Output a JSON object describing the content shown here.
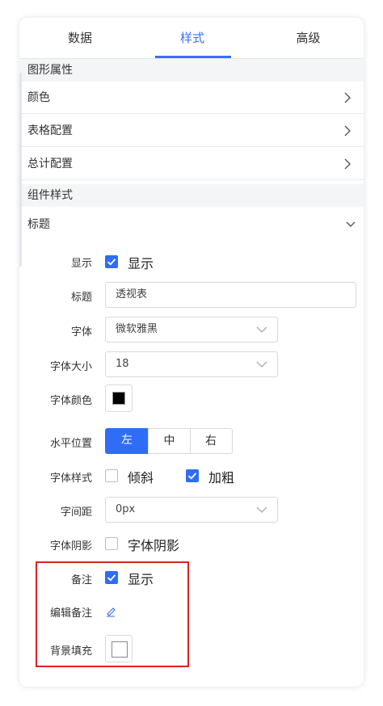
{
  "tabs": [
    "数据",
    "样式",
    "高级"
  ],
  "active_tab": "样式",
  "sections": {
    "graphic_properties": "图形属性",
    "component_style": "组件样式"
  },
  "collapsed_rows": [
    "颜色",
    "表格配置",
    "总计配置"
  ],
  "title_group": "标题",
  "fields": {
    "show_label": "显示",
    "show_text": "显示",
    "title_label": "标题",
    "title_value": "透视表",
    "font_label": "字体",
    "font_value": "微软雅黑",
    "font_size_label": "字体大小",
    "font_size_value": "18",
    "font_color_label": "字体颜色",
    "font_color_value": "#000000",
    "h_align_label": "水平位置",
    "h_align_options": [
      "左",
      "中",
      "右"
    ],
    "h_align_selected": "左",
    "font_style_label": "字体样式",
    "italic_text": "倾斜",
    "italic_checked": false,
    "bold_text": "加粗",
    "bold_checked": true,
    "letter_spacing_label": "字间距",
    "letter_spacing_value": "0px",
    "font_shadow_label": "字体阴影",
    "font_shadow_text": "字体阴影",
    "font_shadow_checked": false,
    "remark_label": "备注",
    "remark_text": "显示",
    "remark_checked": true,
    "edit_remark_label": "编辑备注",
    "bg_fill_label": "背景填充"
  },
  "colors": {
    "accent": "#2f6df6",
    "highlight_border": "#e02020"
  }
}
